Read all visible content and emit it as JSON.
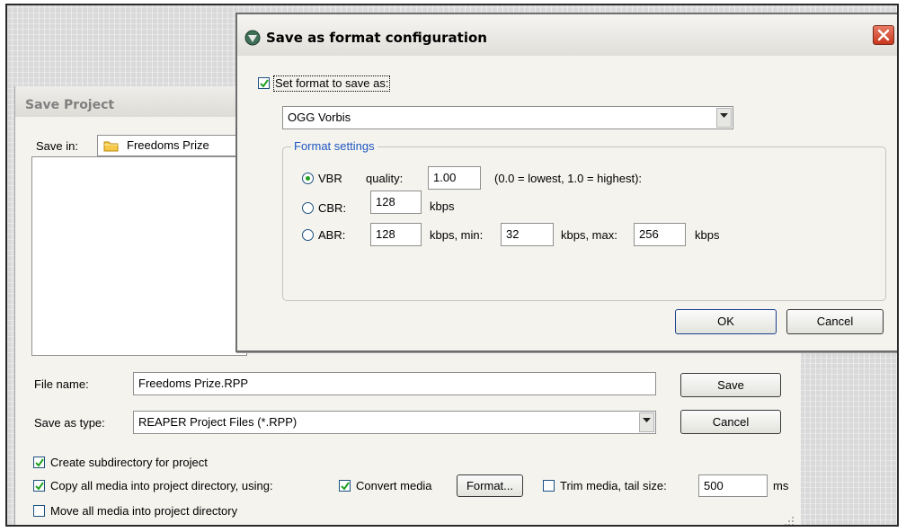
{
  "save_project": {
    "title": "Save Project",
    "save_in_label": "Save in:",
    "save_in_value": "Freedoms Prize",
    "file_name_label": "File name:",
    "file_name_value": "Freedoms Prize.RPP",
    "save_as_type_label": "Save as type:",
    "save_as_type_value": "REAPER Project Files (*.RPP)",
    "save_button": "Save",
    "cancel_button": "Cancel",
    "create_subdirectory": {
      "label": "Create subdirectory for project",
      "checked": true
    },
    "copy_media": {
      "label": "Copy all media into project directory, using:",
      "checked": true
    },
    "convert_media": {
      "label": "Convert media",
      "checked": true
    },
    "format_button": "Format...",
    "trim_media": {
      "label": "Trim media, tail size:",
      "checked": false
    },
    "tail_size_value": "500",
    "tail_size_unit": "ms",
    "move_media": {
      "label": "Move all media into project directory",
      "checked": false
    }
  },
  "format_dialog": {
    "title": "Save as format configuration",
    "set_format_label": "Set format to save as:",
    "set_format_checked": true,
    "format_value": "OGG Vorbis",
    "group_label": "Format settings",
    "selected_mode": "VBR",
    "vbr": {
      "label": "VBR",
      "quality_label": "quality:",
      "quality_value": "1.00",
      "hint": "(0.0 = lowest, 1.0 = highest):"
    },
    "cbr": {
      "label": "CBR:",
      "value": "128",
      "unit": "kbps"
    },
    "abr": {
      "label": "ABR:",
      "value": "128",
      "min_label": "kbps, min:",
      "min_value": "32",
      "max_label": "kbps, max:",
      "max_value": "256",
      "unit": "kbps"
    },
    "ok_button": "OK",
    "cancel_button": "Cancel"
  },
  "colors": {
    "close_button": "#d9472f",
    "radio_selected": "#21a121",
    "panel_bg": "#f4f3ee"
  }
}
